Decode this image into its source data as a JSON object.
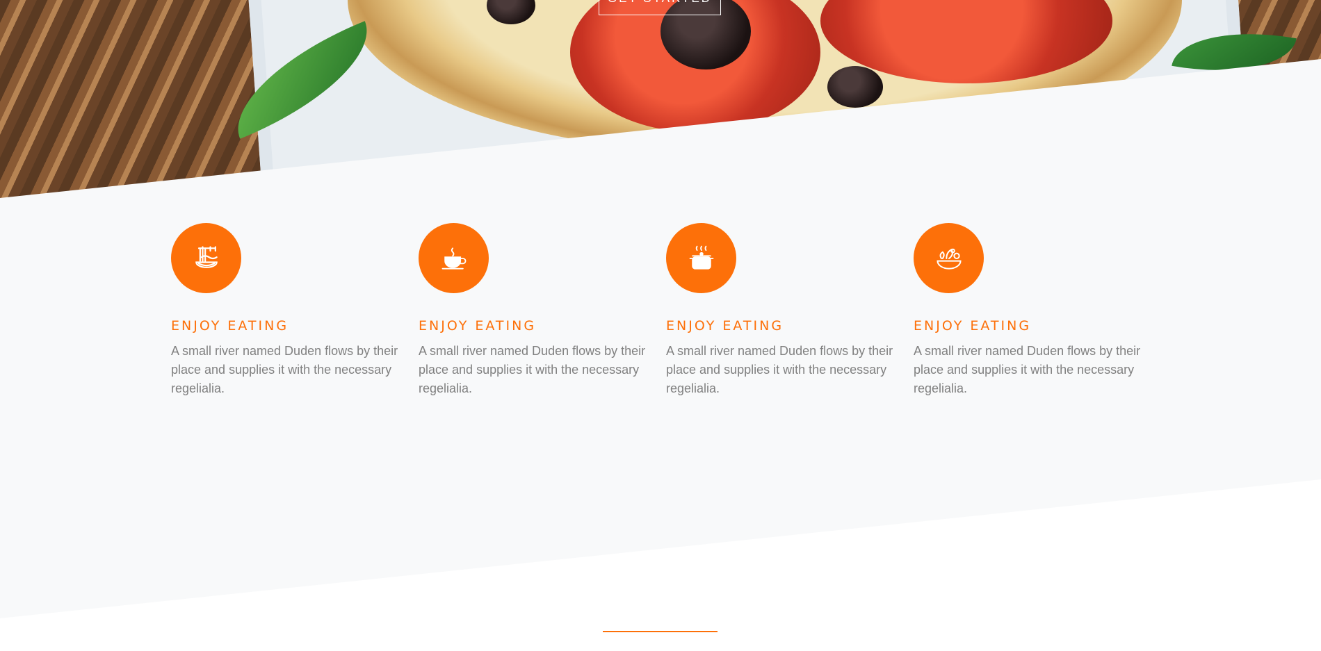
{
  "hero": {
    "cta_label": "GET STARTED"
  },
  "colors": {
    "accent": "#fd7009",
    "section_bg": "#f8f9fa",
    "text_muted": "#808080"
  },
  "features": [
    {
      "icon": "noodles-icon",
      "title": "ENJOY EATING",
      "text": "A small river named Duden flows by their place and supplies it with the necessary regelialia."
    },
    {
      "icon": "coffee-cup-icon",
      "title": "ENJOY EATING",
      "text": "A small river named Duden flows by their place and supplies it with the necessary regelialia."
    },
    {
      "icon": "cooking-pot-icon",
      "title": "ENJOY EATING",
      "text": "A small river named Duden flows by their place and supplies it with the necessary regelialia."
    },
    {
      "icon": "salad-bowl-icon",
      "title": "ENJOY EATING",
      "text": "A small river named Duden flows by their place and supplies it with the necessary regelialia."
    }
  ]
}
